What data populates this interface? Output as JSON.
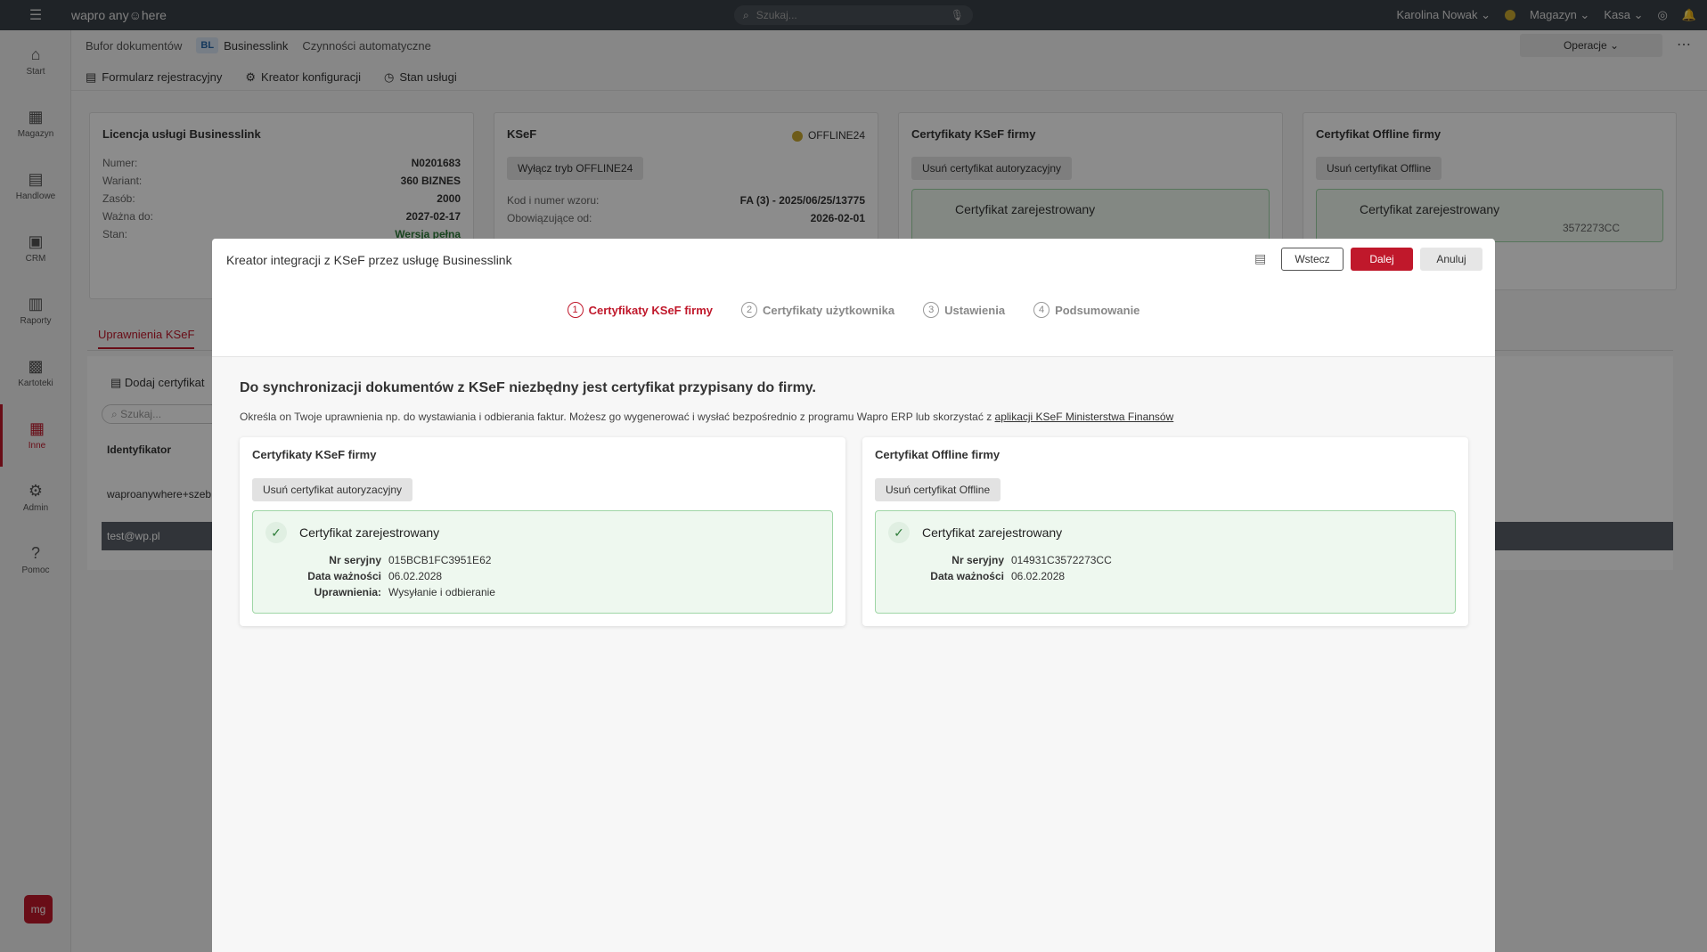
{
  "app": {
    "logo": "wapro any☺here"
  },
  "topbar": {
    "search_placeholder": "Szukaj...",
    "user": "Karolina Nowak",
    "warehouse": "Magazyn",
    "cash": "Kasa"
  },
  "sidebar": {
    "items": [
      {
        "label": "Start",
        "icon": "⌂"
      },
      {
        "label": "Magazyn",
        "icon": "▦"
      },
      {
        "label": "Handlowe",
        "icon": "▤"
      },
      {
        "label": "CRM",
        "icon": "▣"
      },
      {
        "label": "Raporty",
        "icon": "▥"
      },
      {
        "label": "Kartoteki",
        "icon": "▩"
      },
      {
        "label": "Inne",
        "icon": "▦"
      },
      {
        "label": "Admin",
        "icon": "⚙"
      },
      {
        "label": "Pomoc",
        "icon": "?"
      }
    ],
    "bottom_logo": "mg"
  },
  "tabs": {
    "buffer": "Bufor dokumentów",
    "bl_badge": "BL",
    "businesslink": "Businesslink",
    "auto": "Czynności automatyczne",
    "operations": "Operacje"
  },
  "toolbar": {
    "form": "Formularz rejestracyjny",
    "creator": "Kreator konfiguracji",
    "status": "Stan usługi"
  },
  "bg": {
    "license": {
      "title": "Licencja usługi Businesslink",
      "rows": [
        {
          "k": "Numer:",
          "v": "N0201683"
        },
        {
          "k": "Wariant:",
          "v": "360 BIZNES"
        },
        {
          "k": "Zasób:",
          "v": "2000"
        },
        {
          "k": "Ważna do:",
          "v": "2027-02-17"
        },
        {
          "k": "Stan:",
          "v": "Wersja pełna"
        }
      ]
    },
    "ksef": {
      "title": "KSeF",
      "mode": "OFFLINE24",
      "btn": "Wyłącz tryb OFFLINE24",
      "rows": [
        {
          "k": "Kod i numer wzoru:",
          "v": "FA (3) - 2025/06/25/13775"
        },
        {
          "k": "Obowiązujące od:",
          "v": "2026-02-01"
        }
      ]
    },
    "certs": {
      "title": "Certyfikaty KSeF firmy",
      "btn": "Usuń certyfikat autoryzacyjny",
      "status": "Certyfikat zarejestrowany"
    },
    "offline": {
      "title": "Certyfikat Offline firmy",
      "btn": "Usuń certyfikat Offline",
      "status": "Certyfikat zarejestrowany",
      "serial_partial": "3572273CC"
    },
    "perm_tab": "Uprawnienia KSeF",
    "add_cert": "Dodaj certyfikat",
    "search_placeholder": "Szukaj...",
    "col_id": "Identyfikator",
    "row1": "waproanywhere+szeb",
    "row2": "test@wp.pl"
  },
  "dialog": {
    "title": "Kreator integracji z KSeF przez usługę Businesslink",
    "back": "Wstecz",
    "next": "Dalej",
    "cancel": "Anuluj",
    "steps": [
      {
        "num": "1",
        "label": "Certyfikaty KSeF firmy"
      },
      {
        "num": "2",
        "label": "Certyfikaty użytkownika"
      },
      {
        "num": "3",
        "label": "Ustawienia"
      },
      {
        "num": "4",
        "label": "Podsumowanie"
      }
    ],
    "heading": "Do synchronizacji dokumentów z KSeF niezbędny jest certyfikat przypisany do firmy.",
    "desc": "Określa on Twoje uprawnienia np. do wystawiania i odbierania faktur. Możesz go wygenerować i wysłać bezpośrednio z programu Wapro ERP lub skorzystać z ",
    "desc_link": "aplikacji KSeF Ministerstwa Finansów",
    "left_card": {
      "title": "Certyfikaty KSeF firmy",
      "remove": "Usuń certyfikat autoryzacyjny",
      "status": "Certyfikat zarejestrowany",
      "rows": [
        {
          "k": "Nr seryjny",
          "v": "015BCB1FC3951E62"
        },
        {
          "k": "Data ważności",
          "v": "06.02.2028"
        },
        {
          "k": "Uprawnienia:",
          "v": "Wysyłanie i odbieranie"
        }
      ]
    },
    "right_card": {
      "title": "Certyfikat Offline firmy",
      "remove": "Usuń certyfikat Offline",
      "status": "Certyfikat zarejestrowany",
      "rows": [
        {
          "k": "Nr seryjny",
          "v": "014931C3572273CC"
        },
        {
          "k": "Data ważności",
          "v": "06.02.2028"
        }
      ]
    }
  },
  "colors": {
    "accent": "#c0182b",
    "green_bg": "#eef8ef",
    "green_border": "#9fd6a6",
    "topbar": "#3a4048"
  }
}
